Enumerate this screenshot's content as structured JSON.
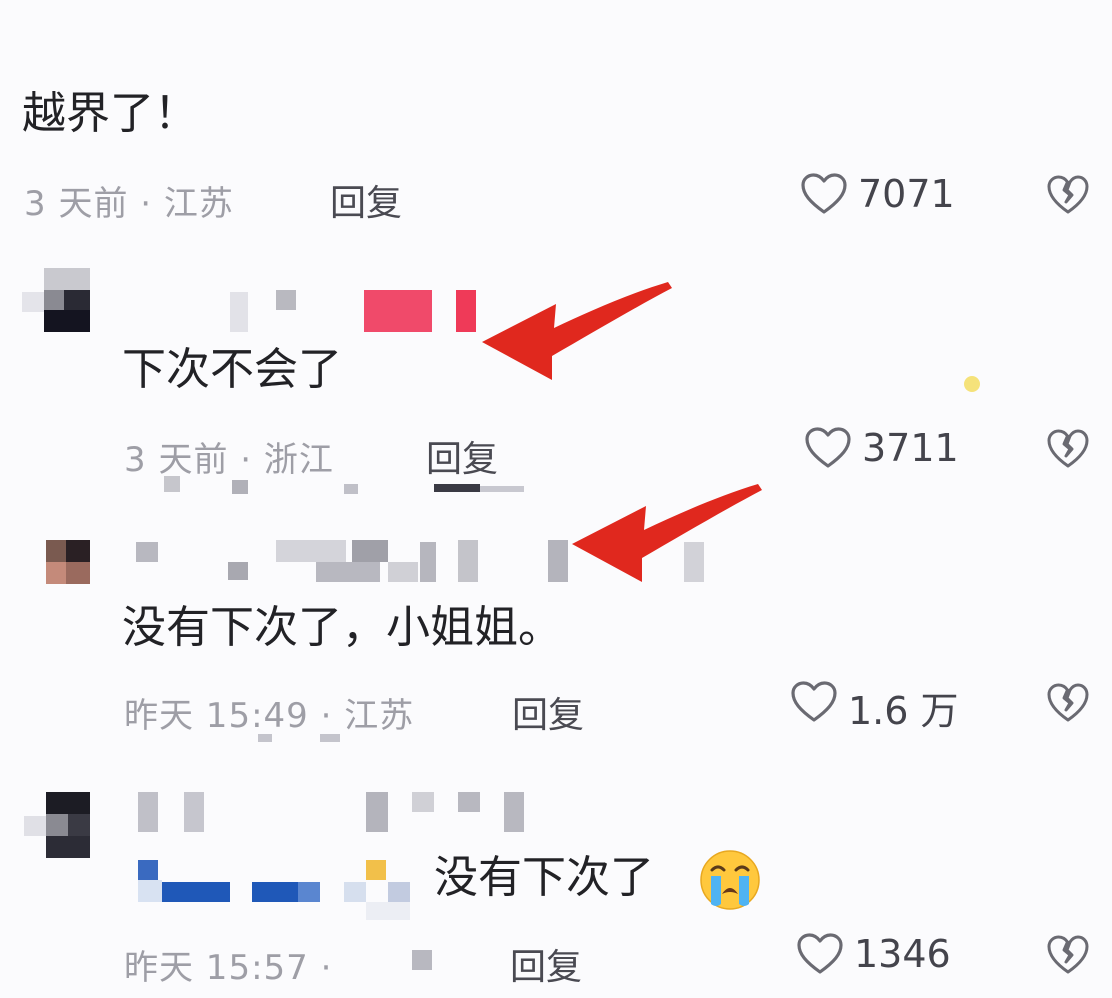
{
  "comments": [
    {
      "text": "越界了！",
      "time_location": "3 天前 · 江苏",
      "reply_label": "回复",
      "likes": "7071"
    },
    {
      "text": "下次不会了",
      "time_location": "3 天前 · 浙江",
      "reply_label": "回复",
      "likes": "3711"
    },
    {
      "text": "没有下次了，小姐姐。",
      "time_location": "昨天 15:49 · 江苏",
      "reply_label": "回复",
      "likes": "1.6 万"
    },
    {
      "text": "没有下次了",
      "time_location": "昨天 15:57 ·",
      "reply_label": "回复",
      "likes": "1346"
    }
  ],
  "icons": {
    "like": "heart-outline-icon",
    "dislike": "broken-heart-icon",
    "annotation": "red-arrow",
    "emoji": "crying-face-emoji"
  },
  "colors": {
    "annotation_arrow": "#e0281e",
    "blurred_badge": "#f04a6a",
    "meta_text": "#9e9ea6",
    "emoji_face": "#ffc83d",
    "emoji_tears": "#4fb3f2"
  }
}
